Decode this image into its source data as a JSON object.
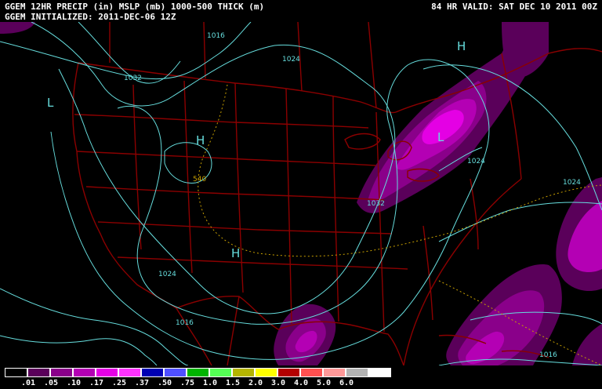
{
  "header": {
    "line1_left": "GGEM 12HR PRECIP (in) MSLP (mb) 1000-500 THICK (m)",
    "line2_left": "GGEM INITIALIZED: 2011-DEC-06 12Z",
    "line1_right": "84 HR VALID: SAT DEC 10 2011 00Z"
  },
  "map_labels": {
    "pressure_centers": [
      "L",
      "H",
      "H",
      "H",
      "L"
    ],
    "isobars": [
      "1016",
      "1024",
      "1032",
      "1024",
      "1032",
      "1024",
      "1024",
      "1016",
      "1016"
    ],
    "thickness": [
      "540"
    ]
  },
  "colors": {
    "background": "#000000",
    "isobar": "#66dddd",
    "borders": "#8b0000",
    "thickness": "#c8a000",
    "precip_01": "#5a005a",
    "precip_05": "#8a008a",
    "precip_10": "#b400b4",
    "precip_17": "#e400e4",
    "precip_25": "#ff33ff"
  },
  "legend": {
    "ticks": [
      ".01",
      ".05",
      ".10",
      ".17",
      ".25",
      ".37",
      ".50",
      ".75",
      "1.0",
      "1.5",
      "2.0",
      "3.0",
      "4.0",
      "5.0",
      "6.0"
    ],
    "colors": [
      "#000000",
      "#5a005a",
      "#8a008a",
      "#b400b4",
      "#e400e4",
      "#ff33ff",
      "#0000b4",
      "#5050ff",
      "#00b400",
      "#55ff55",
      "#b4b400",
      "#ffff00",
      "#b40000",
      "#ff5050",
      "#ff9999",
      "#b4b4b4",
      "#ffffff"
    ]
  }
}
